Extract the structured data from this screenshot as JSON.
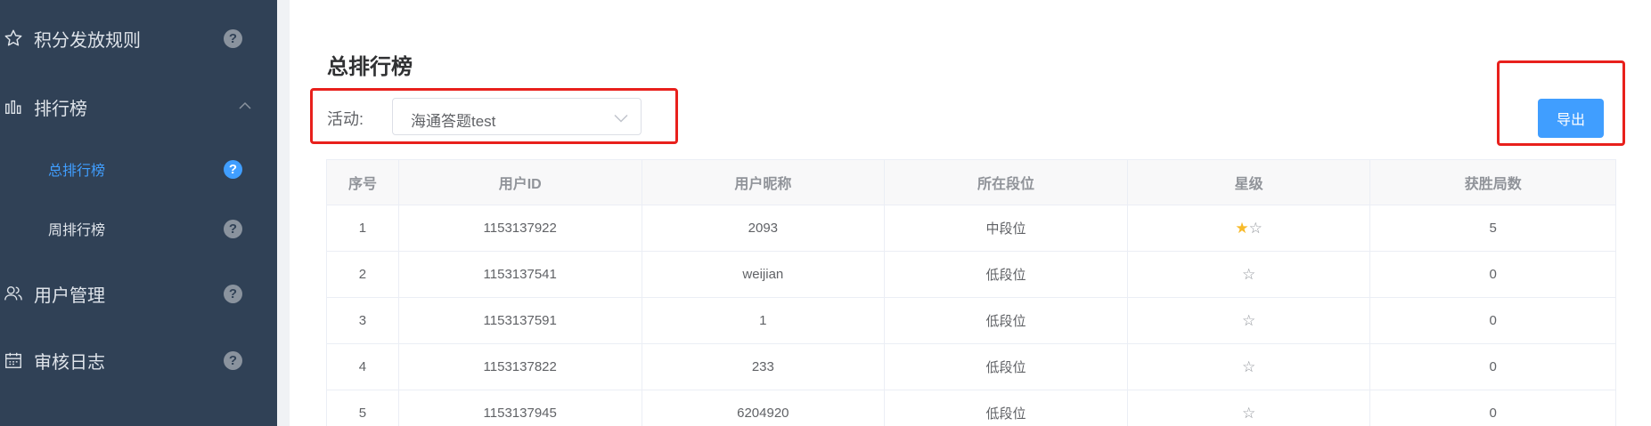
{
  "sidebar": {
    "items": [
      {
        "label": "积分发放规则",
        "icon": "star-outline-icon",
        "help": "?"
      },
      {
        "label": "排行榜",
        "icon": "bar-chart-icon",
        "expanded": true
      },
      {
        "label": "总排行榜",
        "sub": true,
        "active": true,
        "help": "?"
      },
      {
        "label": "周排行榜",
        "sub": true,
        "help": "?"
      },
      {
        "label": "用户管理",
        "icon": "users-icon",
        "help": "?"
      },
      {
        "label": "审核日志",
        "icon": "calendar-icon",
        "help": "?"
      }
    ]
  },
  "main": {
    "title": "总排行榜",
    "filter": {
      "label": "活动:",
      "value": "海通答题test"
    },
    "export_label": "导出"
  },
  "table": {
    "headers": [
      "序号",
      "用户ID",
      "用户昵称",
      "所在段位",
      "星级",
      "获胜局数"
    ],
    "rows": [
      {
        "index": "1",
        "user_id": "1153137922",
        "nickname": "2093",
        "rank": "中段位",
        "stars_filled": 1,
        "stars_total": 2,
        "wins": "5"
      },
      {
        "index": "2",
        "user_id": "1153137541",
        "nickname": "weijian",
        "rank": "低段位",
        "stars_filled": 0,
        "stars_total": 1,
        "wins": "0"
      },
      {
        "index": "3",
        "user_id": "1153137591",
        "nickname": "1",
        "rank": "低段位",
        "stars_filled": 0,
        "stars_total": 1,
        "wins": "0"
      },
      {
        "index": "4",
        "user_id": "1153137822",
        "nickname": "233",
        "rank": "低段位",
        "stars_filled": 0,
        "stars_total": 1,
        "wins": "0"
      },
      {
        "index": "5",
        "user_id": "1153137945",
        "nickname": "6204920",
        "rank": "低段位",
        "stars_filled": 0,
        "stars_total": 1,
        "wins": "0"
      }
    ]
  },
  "colors": {
    "sidebar_bg": "#304156",
    "accent": "#409eff",
    "highlight_border": "#e8201c",
    "star_on": "#f7ba2a"
  }
}
